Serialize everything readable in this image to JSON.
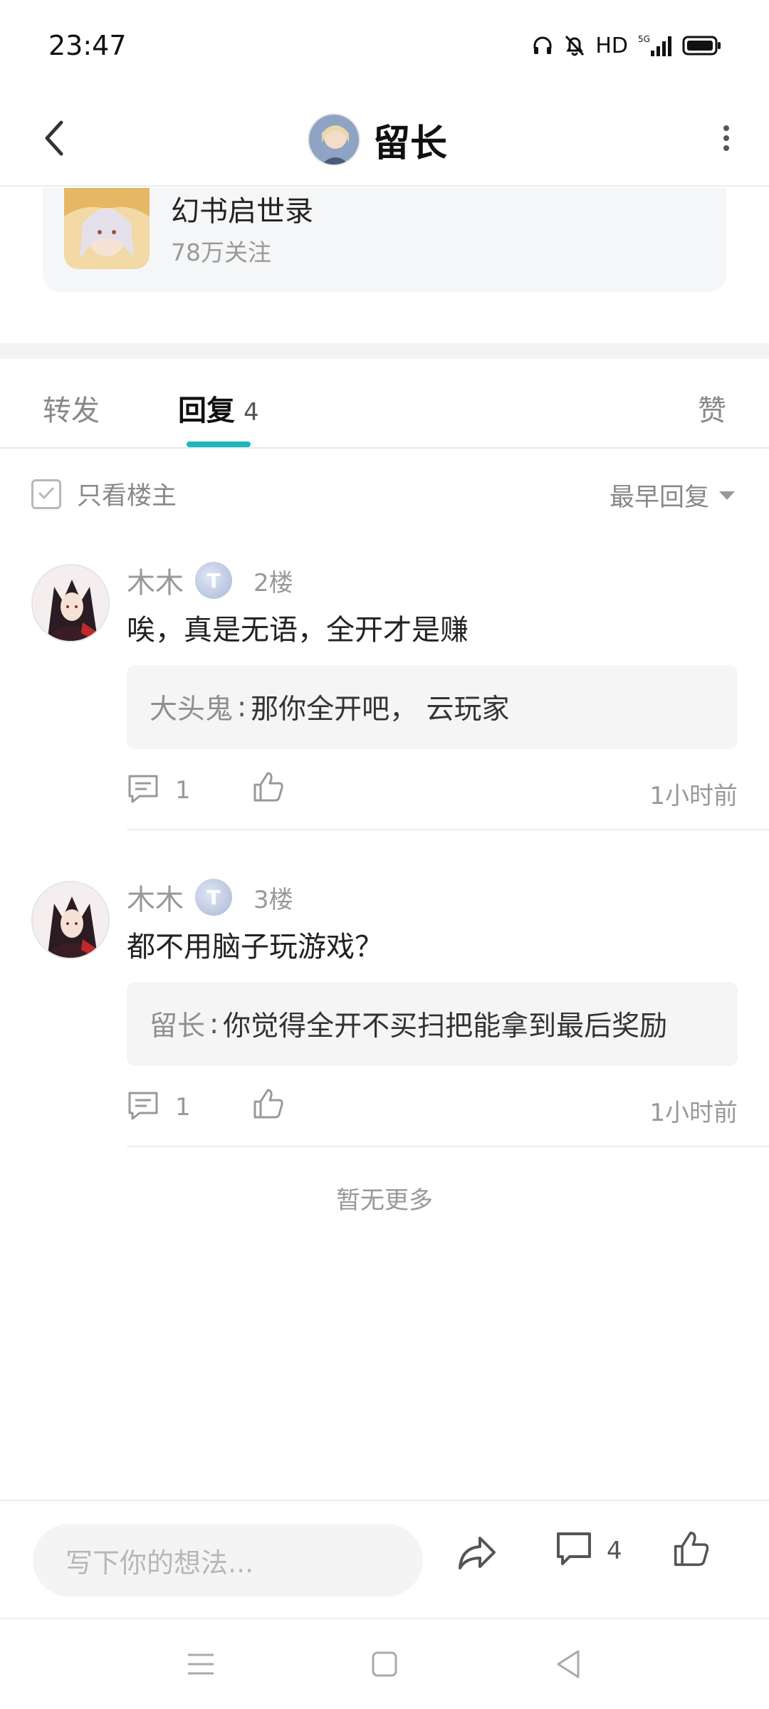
{
  "status_bar": {
    "time": "23:47",
    "network_label": "HD",
    "icons": [
      "headphones-icon",
      "bell-off-icon",
      "signal-5g-icon",
      "battery-icon"
    ]
  },
  "header": {
    "title": "留长",
    "icons": [
      "back-arrow-icon",
      "more-vertical-icon"
    ]
  },
  "forum_card": {
    "name": "幻书启世录",
    "followers": "78万关注"
  },
  "tabs": {
    "forward_label": "转发",
    "reply_label": "回复",
    "reply_count": "4",
    "like_label": "赞",
    "active": "reply",
    "accent_color": "#1fb5bd"
  },
  "filter": {
    "only_op_label": "只看楼主",
    "sort_label": "最早回复"
  },
  "replies": [
    {
      "author": "木木",
      "badge": "T",
      "floor": "2楼",
      "text": "唉，真是无语，全开才是赚",
      "quote_author": "大头鬼",
      "quote_sep": ":",
      "quote_text": "那你全开吧， 云玩家",
      "comment_count": "1",
      "time": "1小时前"
    },
    {
      "author": "木木",
      "badge": "T",
      "floor": "3楼",
      "text": "都不用脑子玩游戏？",
      "quote_author": "留长",
      "quote_sep": ":",
      "quote_text": "你觉得全开不买扫把能拿到最后奖励",
      "comment_count": "1",
      "time": "1小时前"
    }
  ],
  "no_more_label": "暂无更多",
  "bottom_bar": {
    "input_placeholder": "写下你的想法...",
    "comment_count": "4",
    "icons": [
      "share-icon",
      "comment-icon",
      "thumbs-up-icon"
    ]
  },
  "nav_bar": {
    "icons": [
      "menu-icon",
      "home-square-icon",
      "back-triangle-icon"
    ]
  }
}
